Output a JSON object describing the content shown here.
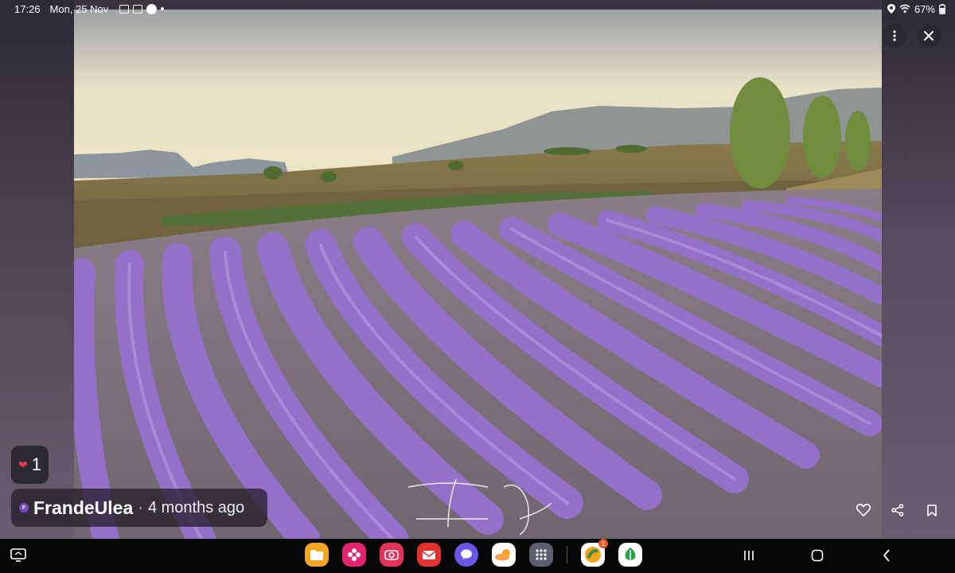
{
  "status_bar": {
    "time": "17:26",
    "date": "Mon, 25 Nov",
    "battery": "67%"
  },
  "photo": {
    "subject": "lavender-field-photo"
  },
  "post": {
    "likes": "1",
    "author_initial": "F",
    "author": "FrandeUlea",
    "separator": "·",
    "time_ago": "4 months ago"
  },
  "icons": {
    "more": "more-vert-icon",
    "close": "close-icon",
    "heart": "heart-icon",
    "share": "share-icon",
    "bookmark": "bookmark-icon"
  },
  "dock": {
    "apps": [
      "my-files",
      "gallery",
      "camera",
      "email",
      "messages",
      "weather",
      "app-drawer",
      "news",
      "notes"
    ],
    "badge_count": "1"
  },
  "colors": {
    "lavender": "#8f6ac8",
    "sky": "#f3e6b8",
    "heart": "#e53950",
    "nav_bg": "#060606"
  }
}
